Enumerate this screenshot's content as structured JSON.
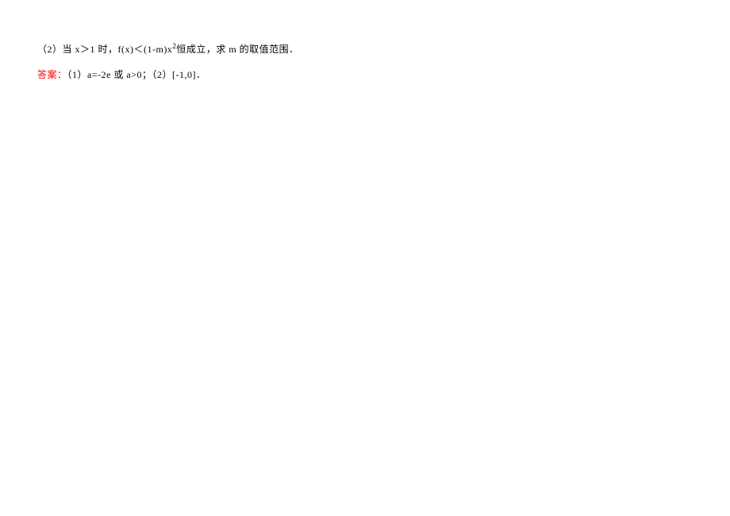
{
  "problem": {
    "part2_prefix": "（2）当 x＞1 时，f(x)＜(1-m)x",
    "part2_sup": "2",
    "part2_suffix": "恒成立，求 m 的取值范围．"
  },
  "answer": {
    "label": "答案：",
    "content": "（1）a=-2e 或 a>0；（2）[-1,0]．"
  }
}
